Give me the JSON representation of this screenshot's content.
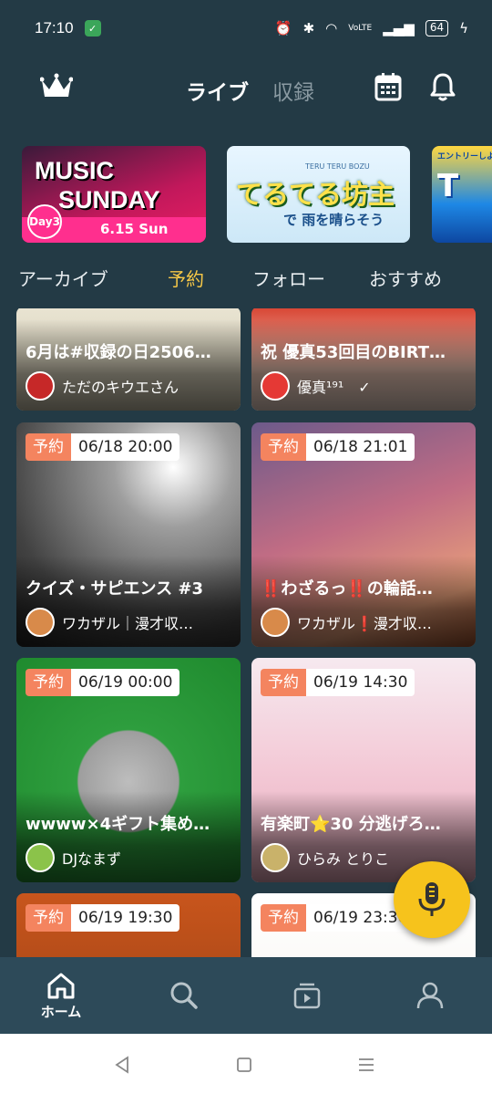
{
  "status": {
    "time": "17:10",
    "battery": "64",
    "net": "VoLTE"
  },
  "header": {
    "segments": [
      {
        "label": "ライブ"
      },
      {
        "label": "収録"
      }
    ]
  },
  "banners": [
    {
      "line1": "MUSIC",
      "line2": "SUNDAY",
      "badge": "Day3",
      "date": "6.15  Sun"
    },
    {
      "small": "TERU TERU BOZU",
      "title": "てるてる坊主",
      "sub": "で 雨を晴らそう"
    },
    {
      "top": "エントリーしよ",
      "big": "T"
    }
  ],
  "tabs": [
    {
      "label": "アーカイブ"
    },
    {
      "label": "予約"
    },
    {
      "label": "フォロー"
    },
    {
      "label": "おすすめ"
    }
  ],
  "cards": [
    {
      "title": "6月は#収録の日2506…",
      "user": "ただのキウエさん"
    },
    {
      "title": "祝 優真53回目のBIRT…",
      "user": "優真¹⁹¹　✓"
    },
    {
      "tag": "予約",
      "time": "06/18 20:00",
      "title": "クイズ・サピエンス #3",
      "user": "ワカザル｜漫才収…"
    },
    {
      "tag": "予約",
      "time": "06/18 21:01",
      "title": "‼️わざるっ‼️の輪話…",
      "user": "ワカザル❗️漫才収…"
    },
    {
      "tag": "予約",
      "time": "06/19 00:00",
      "title": "wwww×4ギフト集め…",
      "user": "DJなまず"
    },
    {
      "tag": "予約",
      "time": "06/19 14:30",
      "title": "有楽町⭐30 分逃げろ…",
      "user": "ひらみ とりこ"
    },
    {
      "tag": "予約",
      "time": "06/19 19:30"
    },
    {
      "tag": "予約",
      "time": "06/19 23:30"
    }
  ],
  "bottom_nav": [
    {
      "label": "ホーム",
      "icon": "home-icon"
    },
    {
      "icon": "search-icon"
    },
    {
      "icon": "video-list-icon"
    },
    {
      "icon": "profile-icon"
    }
  ],
  "colors": {
    "background": "#233a45",
    "accent_tab": "#f6c747",
    "reserve_badge": "#f4845f",
    "fab": "#f6c31c"
  }
}
